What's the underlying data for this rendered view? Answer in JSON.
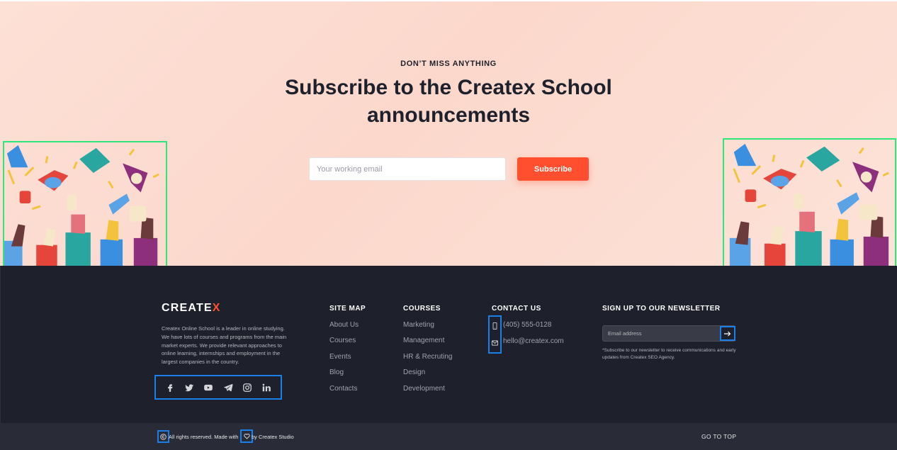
{
  "subscribe": {
    "eyebrow": "DON’T MISS ANYTHING",
    "title": "Subscribe to the Createx School announcements",
    "email_placeholder": "Your working email",
    "button": "Subscribe"
  },
  "footer": {
    "logo_main": "CREATE",
    "logo_accent": "X",
    "about": "Createx Online School is a leader in online studying. We have lots of courses and programs from the main market experts. We provide relevant approaches to online learning, internships and employment in the largest companies in the country.",
    "social": [
      "facebook-icon",
      "twitter-icon",
      "youtube-icon",
      "telegram-icon",
      "instagram-icon",
      "linkedin-icon"
    ],
    "site_map": {
      "title": "SITE MAP",
      "links": [
        "About Us",
        "Courses",
        "Events",
        "Blog",
        "Contacts"
      ]
    },
    "courses": {
      "title": "COURSES",
      "links": [
        "Marketing",
        "Management",
        "HR & Recruting",
        "Design",
        "Development"
      ]
    },
    "contact": {
      "title": "CONTACT US",
      "phone": "(405) 555-0128",
      "email": "hello@createx.com"
    },
    "newsletter": {
      "title": "SIGN UP TO OUR NEWSLETTER",
      "placeholder": "Email address",
      "note": "*Subscribe to our newsletter to receive communications and early updates from Createx SEO Agency."
    }
  },
  "bottom": {
    "copyright_part1": "All rights reserved. Made with",
    "copyright_part2": "by Createx Studio",
    "go_to_top": "GO TO TOP"
  },
  "colors": {
    "accent": "#ff4f2e",
    "dark": "#1e212c",
    "highlight_box": "#1a7fe8",
    "illustration_box": "#2ee67a"
  }
}
